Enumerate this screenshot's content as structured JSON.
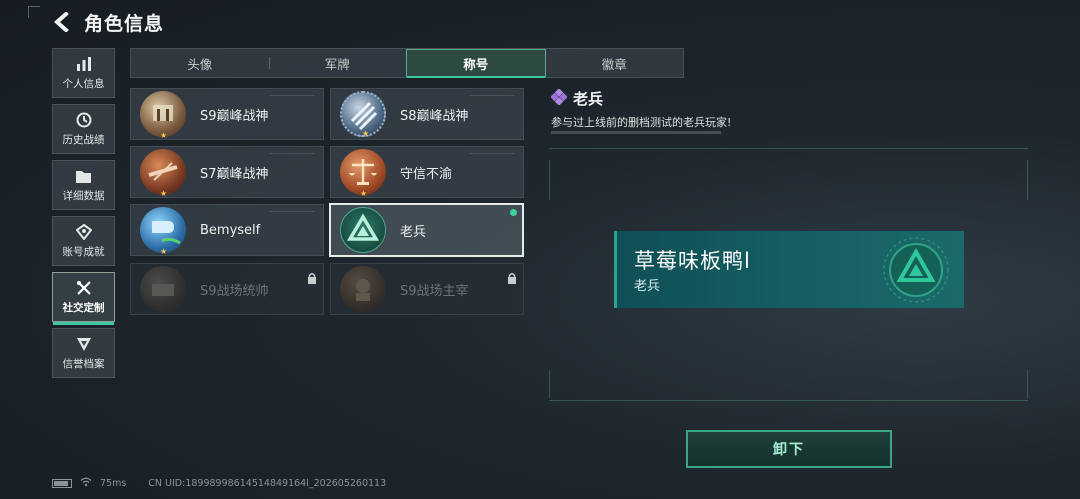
{
  "header": {
    "title": "角色信息"
  },
  "side_nav": {
    "items": [
      {
        "label": "个人信息",
        "icon": "bar-chart-icon"
      },
      {
        "label": "历史战绩",
        "icon": "history-icon"
      },
      {
        "label": "详细数据",
        "icon": "folder-icon"
      },
      {
        "label": "账号成就",
        "icon": "achievement-icon"
      },
      {
        "label": "社交定制",
        "icon": "tools-icon",
        "active": true
      },
      {
        "label": "信誉档案",
        "icon": "credit-icon"
      }
    ]
  },
  "tabs": [
    {
      "label": "头像"
    },
    {
      "label": "军牌"
    },
    {
      "label": "称号",
      "active": true
    },
    {
      "label": "徽章"
    }
  ],
  "titles": [
    {
      "label": "S9巅峰战神",
      "locked": false
    },
    {
      "label": "S8巅峰战神",
      "locked": false
    },
    {
      "label": "S7巅峰战神",
      "locked": false
    },
    {
      "label": "守信不渝",
      "locked": false
    },
    {
      "label": "Bemyself",
      "locked": false
    },
    {
      "label": "老兵",
      "locked": false,
      "selected": true,
      "equipped": true
    },
    {
      "label": "S9战场统帅",
      "locked": true
    },
    {
      "label": "S9战场主宰",
      "locked": true
    }
  ],
  "detail": {
    "title": "老兵",
    "description": "参与过上线前的删档测试的老兵玩家!"
  },
  "nameplate": {
    "player_name": "草莓味板鸭l",
    "title": "老兵"
  },
  "unequip_button": {
    "label": "卸下"
  },
  "status_bar": {
    "ping": "75ms",
    "uid": "CN UID:18998998614514849164l_202605260113"
  },
  "colors": {
    "accent": "#3fc7a0",
    "nameplate_bg": "#155f63",
    "equipped_dot": "#3fd39c"
  }
}
